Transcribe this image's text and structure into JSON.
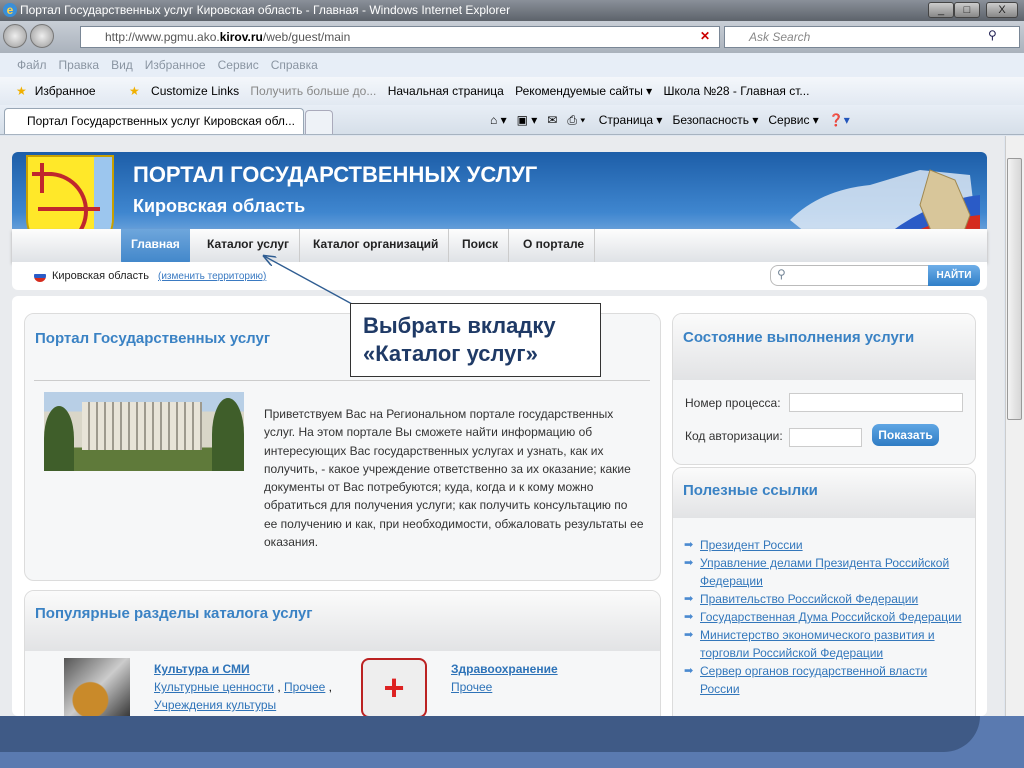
{
  "browser": {
    "title": "Портал Государственных услуг Кировская область - Главная - Windows Internet Explorer",
    "window_buttons": [
      "_",
      "□",
      "X"
    ],
    "address_prefix": "http://www.pgmu.ako.",
    "address_domain": "kirov.ru",
    "address_suffix": "/web/guest/main",
    "search_placeholder": "Ask Search",
    "menu": [
      "Файл",
      "Правка",
      "Вид",
      "Избранное",
      "Сервис",
      "Справка"
    ],
    "favorites": [
      "Избранное",
      "Customize Links",
      "Получить больше до...",
      "Начальная страница",
      "Рекомендуемые сайты ▾",
      "Школа №28 - Главная ст..."
    ],
    "tab_title": "Портал Государственных услуг Кировская обл...",
    "commands": [
      "Страница ▾",
      "Безопасность ▾",
      "Сервис ▾"
    ]
  },
  "header": {
    "title": "ПОРТАЛ ГОСУДАРСТВЕННЫХ УСЛУГ",
    "subtitle": "Кировская область",
    "nav": [
      "Главная",
      "Каталог услуг",
      "Каталог организаций",
      "Поиск",
      "О портале"
    ],
    "active_nav": "Главная",
    "region": "Кировская область",
    "change_region": "(изменить территорию)",
    "search_button": "НАЙТИ"
  },
  "intro": {
    "heading": "Портал Государственных услуг",
    "text": "Приветствуем Вас на Региональном портале государственных услуг. На этом портале Вы сможете найти информацию об интересующих Вас государственных услугах и узнать, как их получить, - какое учреждение ответственно за их оказание; какие документы от Вас потребуются; куда, когда и к кому можно обратиться для получения услуги; как получить консультацию по ее получению и как, при необходимости, обжаловать результаты ее оказания."
  },
  "popular": {
    "heading": "Популярные разделы каталога услуг",
    "categories": [
      {
        "title": "Культура и СМИ",
        "links": [
          "Культурные ценности",
          "Прочее",
          "Учреждения культуры"
        ]
      },
      {
        "title": "Здравоохранение",
        "links": [
          "Прочее"
        ]
      }
    ]
  },
  "status": {
    "heading": "Состояние выполнения услуги",
    "process_label": "Номер процесса:",
    "process_value": "",
    "auth_label": "Код авторизации:",
    "auth_value": "",
    "show_button": "Показать"
  },
  "links": {
    "heading": "Полезные ссылки",
    "items": [
      "Президент России",
      "Управление делами Президента Российской Федерации",
      "Правительство Российской Федерации",
      "Государственная Дума Российской Федерации",
      "Министерство экономического развития и торговли Российской Федерации",
      "Сервер органов государственной власти России"
    ]
  },
  "callout": {
    "text": "Выбрать вкладку «Каталог услуг»"
  },
  "colors": {
    "accent": "#3a82c4",
    "banner": "#2a6fbe",
    "callout_text": "#1f3a66"
  }
}
